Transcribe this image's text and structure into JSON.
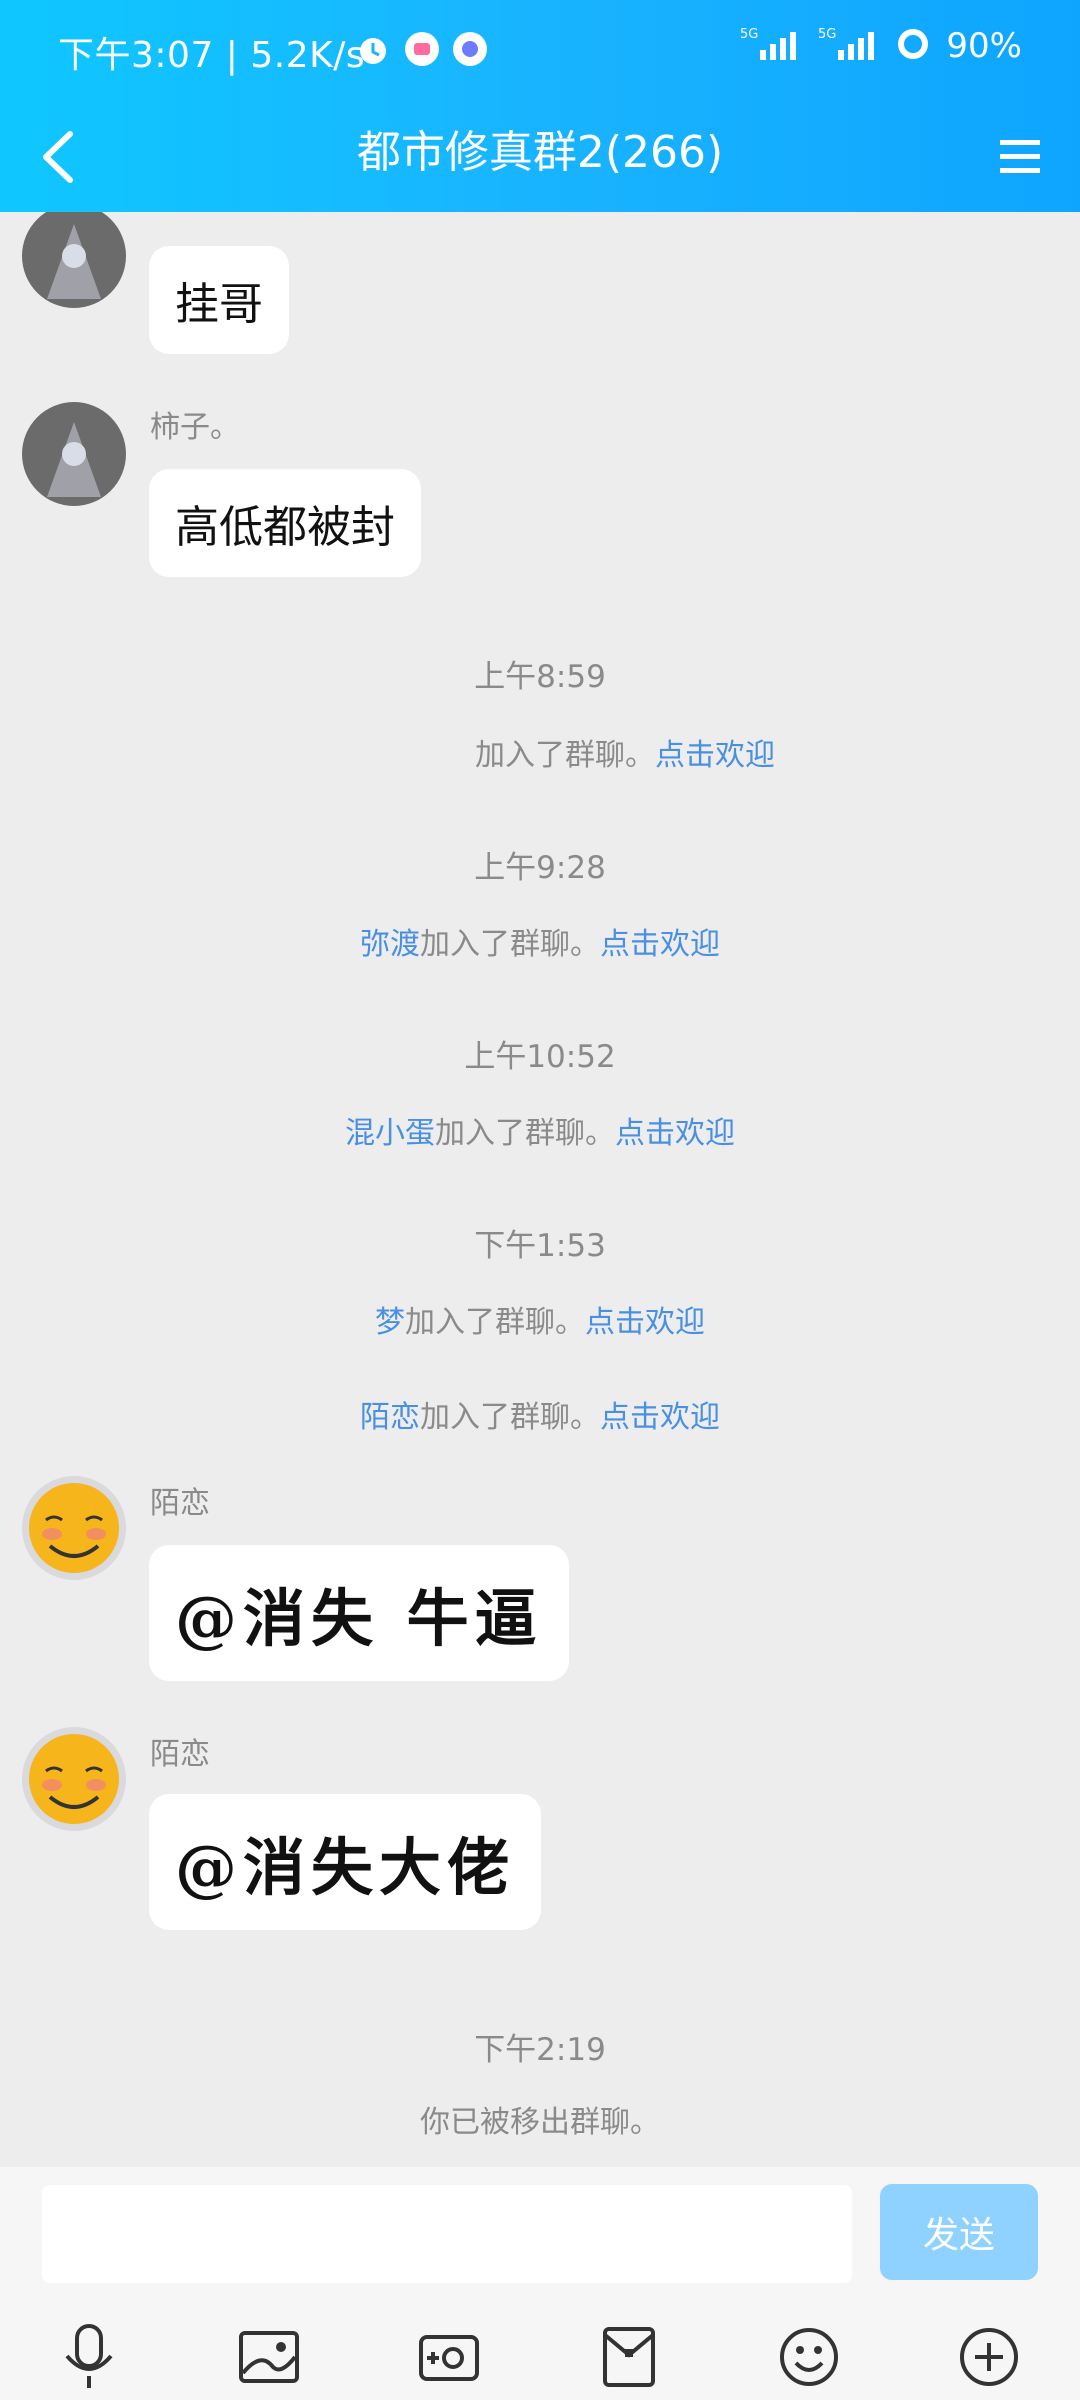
{
  "status_bar": {
    "time_speed": "下午3:07 | 5.2K/s",
    "battery": "90%",
    "signal": "5G"
  },
  "header": {
    "title": "都市修真群2(266)"
  },
  "messages": [
    {
      "type": "bubble",
      "name": "",
      "text": "挂哥"
    },
    {
      "type": "bubble",
      "name": "柿子。",
      "text": "高低都被封"
    },
    {
      "type": "time",
      "text": "上午8:59"
    },
    {
      "type": "system",
      "user": "",
      "text": "加入了群聊。",
      "action": "点击欢迎"
    },
    {
      "type": "time",
      "text": "上午9:28"
    },
    {
      "type": "system",
      "user": "弥渡",
      "text": "加入了群聊。",
      "action": "点击欢迎"
    },
    {
      "type": "time",
      "text": "上午10:52"
    },
    {
      "type": "system",
      "user": "混小蛋",
      "text": "加入了群聊。",
      "action": "点击欢迎"
    },
    {
      "type": "time",
      "text": "下午1:53"
    },
    {
      "type": "system",
      "user": "梦",
      "text": "加入了群聊。",
      "action": "点击欢迎"
    },
    {
      "type": "system",
      "user": "陌恋",
      "text": "加入了群聊。",
      "action": "点击欢迎"
    },
    {
      "type": "bubble",
      "name": "陌恋",
      "text": "@消失 牛逼"
    },
    {
      "type": "bubble",
      "name": "陌恋",
      "text": "@消失大佬"
    },
    {
      "type": "time",
      "text": "下午2:19"
    },
    {
      "type": "system",
      "user": "",
      "text": "你已被移出群聊。",
      "action": ""
    }
  ],
  "composer": {
    "input_placeholder": "",
    "send_label": "发送"
  },
  "toolbar_icons": [
    "microphone-icon",
    "image-icon",
    "camera-icon",
    "red-envelope-icon",
    "emoji-icon",
    "plus-icon"
  ],
  "colors": {
    "header_gradient_start": "#0fc7ff",
    "header_gradient_end": "#0ea5ff",
    "link": "#4a90e2",
    "send_button": "#8fd2ff",
    "background": "#ededed"
  }
}
